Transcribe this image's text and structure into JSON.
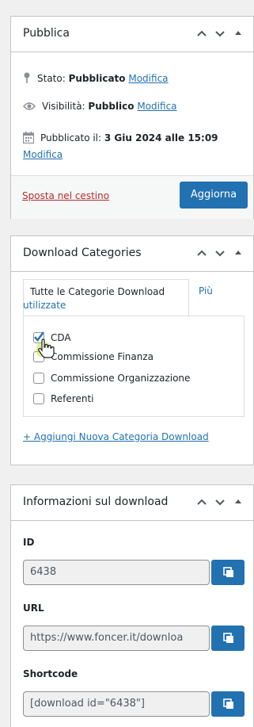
{
  "publish": {
    "title": "Pubblica",
    "status_prefix": "Stato:",
    "status_value": "Pubblicato",
    "status_link": "Modifica",
    "visibility_prefix": "Visibilità:",
    "visibility_value": "Pubblico",
    "visibility_link": "Modifica",
    "date_prefix": "Pubblicato il:",
    "date_value": "3 Giu 2024 alle 15:09",
    "date_link": "Modifica",
    "trash_link": "Sposta nel cestino",
    "update_button": "Aggiorna"
  },
  "categories": {
    "title": "Download Categories",
    "tab_all_line1": "Tutte le Categorie Download",
    "tab_popular_line1": "Più",
    "tab_popular_line2": "utilizzate",
    "items": [
      {
        "label": "CDA",
        "checked": true
      },
      {
        "label": "Commissione Finanza",
        "checked": false
      },
      {
        "label": "Commissione Organizzazione",
        "checked": false
      },
      {
        "label": "Referenti",
        "checked": false
      }
    ],
    "add_link": "+ Aggiungi Nuova Categoria Download"
  },
  "info": {
    "title": "Informazioni sul download",
    "id_label": "ID",
    "id_value": "6438",
    "url_label": "URL",
    "url_value": "https://www.foncer.it/downloa",
    "shortcode_label": "Shortcode",
    "shortcode_value": "[download id=\"6438\"]"
  },
  "colors": {
    "accent": "#2271b1",
    "danger": "#b32d2e",
    "cursor_glow": "#c6e63a"
  }
}
